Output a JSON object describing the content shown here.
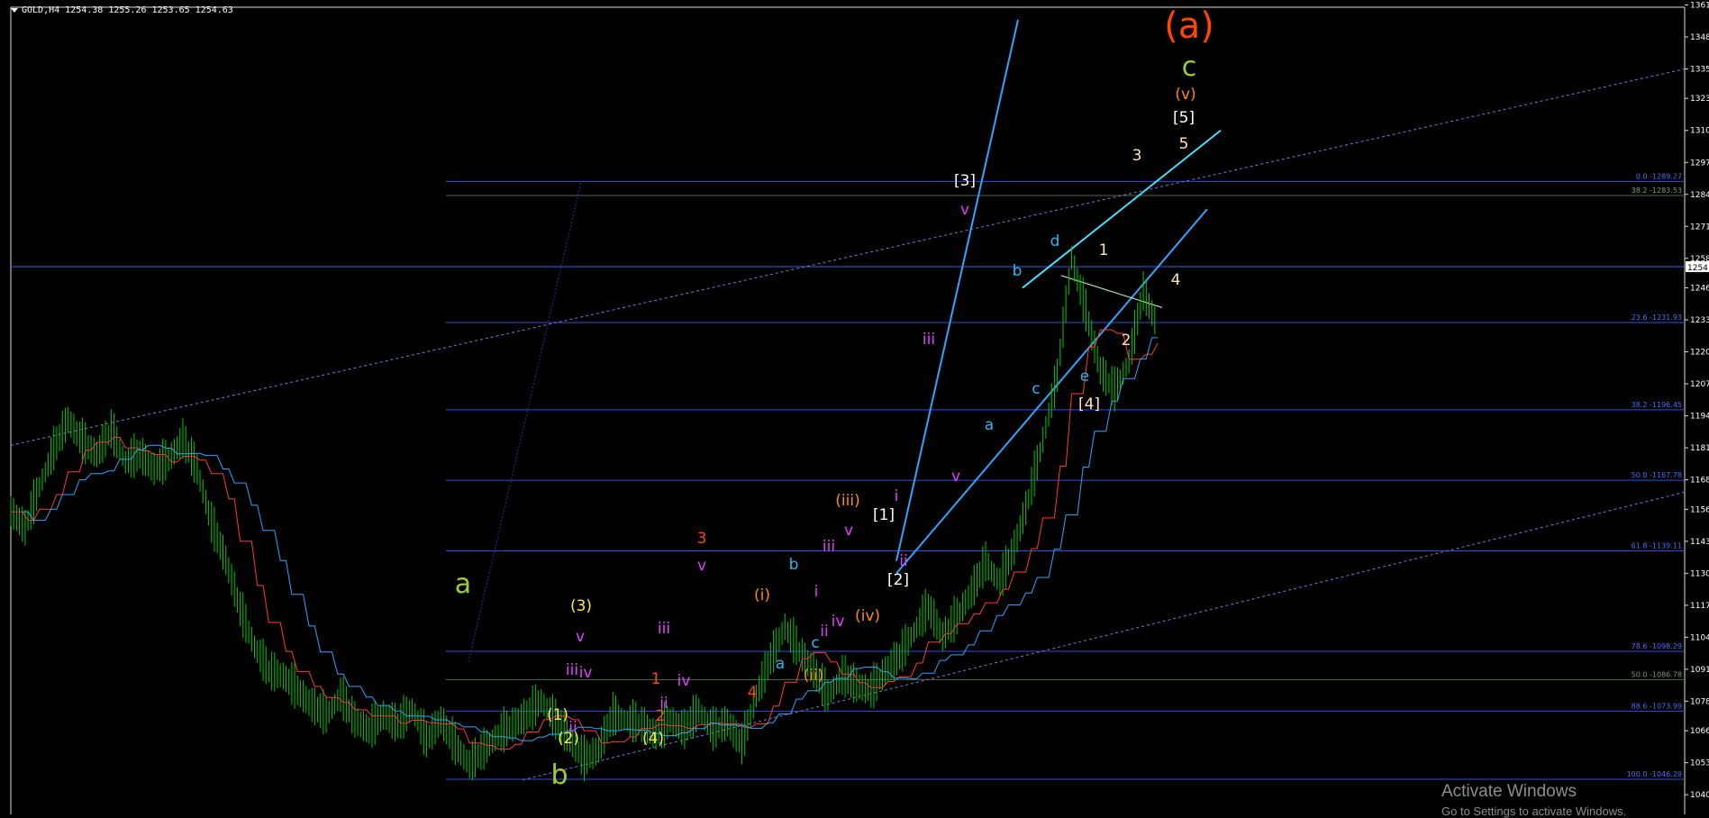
{
  "header": {
    "label": "GOLD,H4  1254.38 1255.26 1253.65 1254.63"
  },
  "watermark": {
    "line1": "Activate Windows",
    "line2": "Go to Settings to activate Windows."
  },
  "current_price": "1254",
  "colors": {
    "background": "#000000",
    "price_bars": "#00c800",
    "ma_fast": "#ff3b30",
    "ma_slow": "#2ea6ff",
    "fib_lines": "#2f4fd8",
    "channel": "#2ea6ff",
    "trendline_dotted": "#7a7ae0"
  },
  "chart_data": {
    "type": "line",
    "instrument": "GOLD",
    "timeframe": "H4",
    "ylim": [
      1032,
      1363
    ],
    "y_ticks": [
      1361,
      1348,
      1335,
      1323,
      1310,
      1297,
      1284,
      1271,
      1258,
      1246,
      1233,
      1220,
      1207,
      1194,
      1181,
      1168,
      1156,
      1143,
      1130,
      1117,
      1104,
      1091,
      1078,
      1066,
      1053,
      1040
    ],
    "x_range": [
      0,
      400
    ],
    "price_path": [
      [
        0,
        1155
      ],
      [
        5,
        1148
      ],
      [
        10,
        1165
      ],
      [
        15,
        1180
      ],
      [
        20,
        1192
      ],
      [
        25,
        1183
      ],
      [
        30,
        1178
      ],
      [
        35,
        1188
      ],
      [
        40,
        1175
      ],
      [
        45,
        1178
      ],
      [
        50,
        1172
      ],
      [
        55,
        1176
      ],
      [
        60,
        1184
      ],
      [
        65,
        1172
      ],
      [
        70,
        1150
      ],
      [
        75,
        1135
      ],
      [
        80,
        1115
      ],
      [
        85,
        1100
      ],
      [
        90,
        1090
      ],
      [
        95,
        1088
      ],
      [
        100,
        1082
      ],
      [
        105,
        1076
      ],
      [
        110,
        1072
      ],
      [
        115,
        1080
      ],
      [
        120,
        1070
      ],
      [
        125,
        1066
      ],
      [
        130,
        1072
      ],
      [
        135,
        1068
      ],
      [
        140,
        1075
      ],
      [
        145,
        1062
      ],
      [
        150,
        1070
      ],
      [
        155,
        1060
      ],
      [
        160,
        1052
      ],
      [
        165,
        1058
      ],
      [
        170,
        1064
      ],
      [
        175,
        1068
      ],
      [
        180,
        1072
      ],
      [
        185,
        1078
      ],
      [
        190,
        1070
      ],
      [
        195,
        1062
      ],
      [
        200,
        1054
      ],
      [
        205,
        1058
      ],
      [
        210,
        1072
      ],
      [
        215,
        1070
      ],
      [
        220,
        1068
      ],
      [
        225,
        1064
      ],
      [
        230,
        1070
      ],
      [
        235,
        1066
      ],
      [
        240,
        1074
      ],
      [
        245,
        1066
      ],
      [
        250,
        1069
      ],
      [
        255,
        1060
      ],
      [
        260,
        1080
      ],
      [
        265,
        1095
      ],
      [
        270,
        1108
      ],
      [
        275,
        1098
      ],
      [
        280,
        1090
      ],
      [
        285,
        1080
      ],
      [
        290,
        1088
      ],
      [
        295,
        1084
      ],
      [
        300,
        1082
      ],
      [
        305,
        1090
      ],
      [
        310,
        1096
      ],
      [
        315,
        1106
      ],
      [
        320,
        1116
      ],
      [
        325,
        1104
      ],
      [
        330,
        1112
      ],
      [
        335,
        1122
      ],
      [
        340,
        1134
      ],
      [
        345,
        1126
      ],
      [
        350,
        1140
      ],
      [
        355,
        1160
      ],
      [
        360,
        1184
      ],
      [
        365,
        1210
      ],
      [
        370,
        1258
      ],
      [
        375,
        1236
      ],
      [
        380,
        1212
      ],
      [
        385,
        1204
      ],
      [
        390,
        1216
      ],
      [
        395,
        1244
      ],
      [
        400,
        1230
      ]
    ],
    "fibonacci_levels": [
      {
        "label": "0.0 -1289.27",
        "price": 1289.27
      },
      {
        "label": "38.2 -1283.53",
        "price": 1283.53
      },
      {
        "label": "23.6 -1231.93",
        "price": 1231.93
      },
      {
        "label": "38.2 -1196.45",
        "price": 1196.45
      },
      {
        "label": "50.0 -1167.78",
        "price": 1167.78
      },
      {
        "label": "61.8 -1139.11",
        "price": 1139.11
      },
      {
        "label": "78.6 -1098.29",
        "price": 1098.29
      },
      {
        "label": "50.0 -1086.78",
        "price": 1086.78
      },
      {
        "label": "88.6 -1073.99",
        "price": 1073.99
      },
      {
        "label": "100.0 -1046.29",
        "price": 1046.29
      }
    ],
    "wave_labels": [
      {
        "text": "(a)",
        "color": "#ff4500",
        "size": "xl"
      },
      {
        "text": "c",
        "color": "#9acd32",
        "size": "lg"
      },
      {
        "text": "(v)",
        "color": "#ff8c00",
        "size": "md"
      },
      {
        "text": "[5]",
        "color": "#ffffff",
        "size": "md"
      },
      {
        "text": "5",
        "color": "#ffe4b5",
        "size": "md"
      },
      {
        "text": "3",
        "color": "#ffe4b5",
        "size": "md"
      },
      {
        "text": "[3]",
        "color": "#ffffff",
        "size": "md"
      },
      {
        "text": "v",
        "color": "#e040fb",
        "size": "md"
      },
      {
        "text": "d",
        "color": "#29b6f6",
        "size": "md"
      },
      {
        "text": "1",
        "color": "#ffe4b5",
        "size": "md"
      },
      {
        "text": "b",
        "color": "#29b6f6",
        "size": "md"
      },
      {
        "text": "4",
        "color": "#ffe4b5",
        "size": "md"
      },
      {
        "text": "iii",
        "color": "#e040fb",
        "size": "md"
      },
      {
        "text": "2",
        "color": "#ffe4b5",
        "size": "md"
      },
      {
        "text": "c",
        "color": "#29b6f6",
        "size": "md"
      },
      {
        "text": "e",
        "color": "#29b6f6",
        "size": "md"
      },
      {
        "text": "[4]",
        "color": "#ffe4b5",
        "size": "md"
      },
      {
        "text": "a",
        "color": "#29b6f6",
        "size": "md"
      },
      {
        "text": "v",
        "color": "#e040fb",
        "size": "md"
      },
      {
        "text": "(iii)",
        "color": "#ff8c00",
        "size": "md"
      },
      {
        "text": "i",
        "color": "#e040fb",
        "size": "md"
      },
      {
        "text": "[1]",
        "color": "#ffffff",
        "size": "md"
      },
      {
        "text": "v",
        "color": "#e040fb",
        "size": "md"
      },
      {
        "text": "iii",
        "color": "#e040fb",
        "size": "md"
      },
      {
        "text": "ii",
        "color": "#e040fb",
        "size": "md"
      },
      {
        "text": "[2]",
        "color": "#ffffff",
        "size": "md"
      },
      {
        "text": "b",
        "color": "#29b6f6",
        "size": "md"
      },
      {
        "text": "i",
        "color": "#e040fb",
        "size": "md"
      },
      {
        "text": "3",
        "color": "#ff4500",
        "size": "md"
      },
      {
        "text": "v",
        "color": "#e040fb",
        "size": "md"
      },
      {
        "text": "(i)",
        "color": "#ff8c00",
        "size": "md"
      },
      {
        "text": "iv",
        "color": "#e040fb",
        "size": "md"
      },
      {
        "text": "(iv)",
        "color": "#ff8c00",
        "size": "md"
      },
      {
        "text": "ii",
        "color": "#e040fb",
        "size": "md"
      },
      {
        "text": "c",
        "color": "#29b6f6",
        "size": "md"
      },
      {
        "text": "a",
        "color": "#29b6f6",
        "size": "md"
      },
      {
        "text": "(ii)",
        "color": "#ff8c00",
        "size": "md"
      },
      {
        "text": "4",
        "color": "#ff4500",
        "size": "md"
      },
      {
        "text": "iii",
        "color": "#e040fb",
        "size": "md"
      },
      {
        "text": "1",
        "color": "#ff4500",
        "size": "md"
      },
      {
        "text": "iv",
        "color": "#e040fb",
        "size": "md"
      },
      {
        "text": "ii",
        "color": "#e040fb",
        "size": "md"
      },
      {
        "text": "2",
        "color": "#ff4500",
        "size": "md"
      },
      {
        "text": "(4)",
        "color": "#ffeb3b",
        "size": "md"
      },
      {
        "text": "a",
        "color": "#9acd32",
        "size": "lg"
      },
      {
        "text": "(3)",
        "color": "#ffeb3b",
        "size": "md"
      },
      {
        "text": "v",
        "color": "#e040fb",
        "size": "md"
      },
      {
        "text": "iii",
        "color": "#e040fb",
        "size": "md"
      },
      {
        "text": "iv",
        "color": "#e040fb",
        "size": "md"
      },
      {
        "text": "(1)",
        "color": "#ffeb3b",
        "size": "md"
      },
      {
        "text": "ii",
        "color": "#e040fb",
        "size": "md"
      },
      {
        "text": "(2)",
        "color": "#ffeb3b",
        "size": "md"
      },
      {
        "text": "b",
        "color": "#9acd32",
        "size": "lg"
      }
    ]
  }
}
